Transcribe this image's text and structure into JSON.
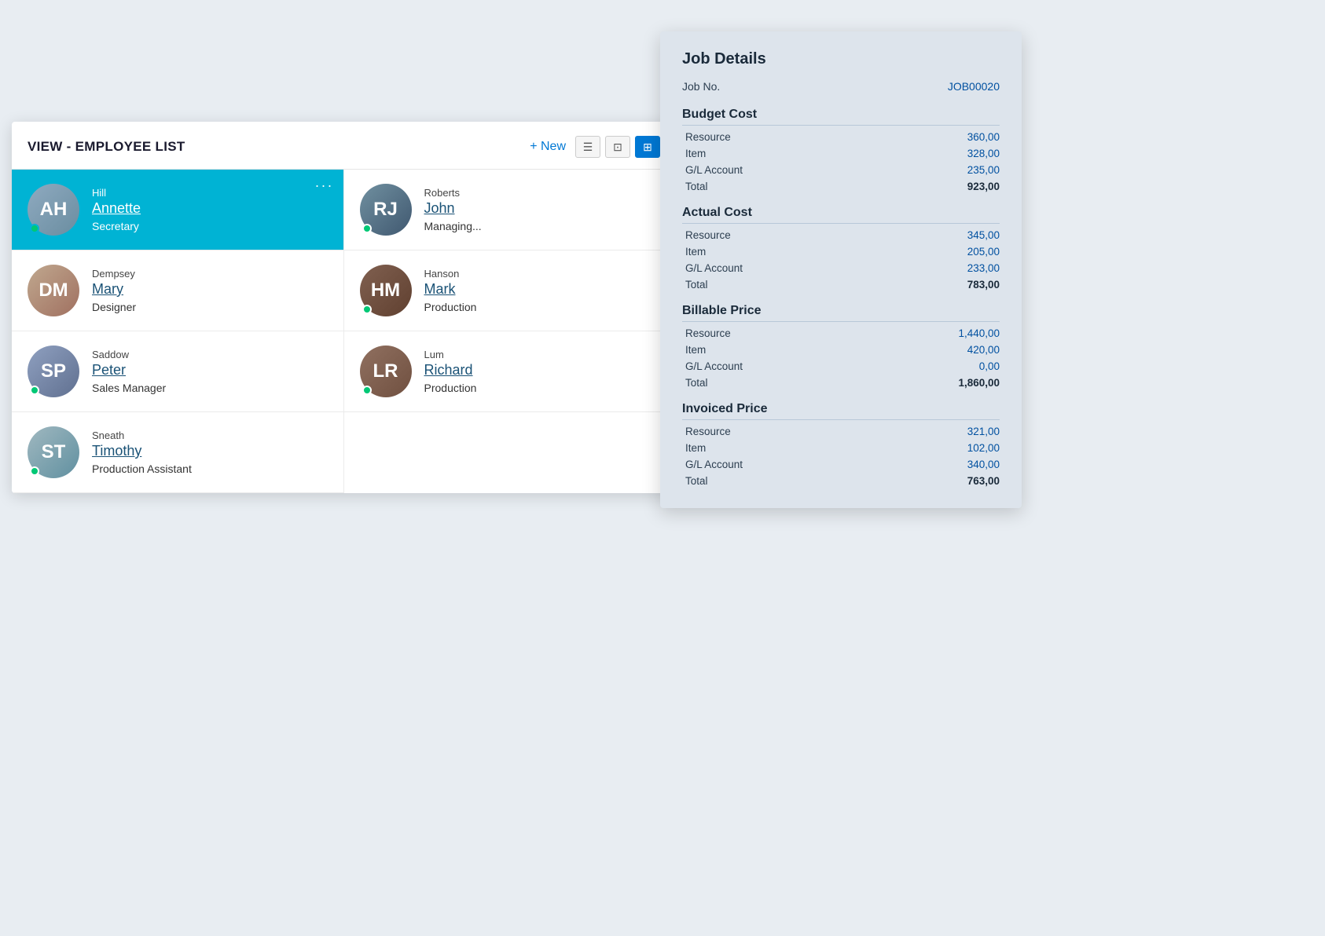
{
  "header": {
    "title": "VIEW - EMPLOYEE LIST",
    "new_label": "+ New"
  },
  "view_icons": [
    {
      "id": "list",
      "icon": "☰",
      "active": false
    },
    {
      "id": "tile",
      "icon": "⊞",
      "active": false
    },
    {
      "id": "grid",
      "icon": "⊟",
      "active": true
    }
  ],
  "employees": [
    {
      "id": "annette",
      "last": "Hill",
      "first": "Annette",
      "role": "Secretary",
      "active": true,
      "avatar_class": "av-annette",
      "initials": "AH",
      "online": true
    },
    {
      "id": "roberts",
      "last": "Roberts",
      "first": "John",
      "role": "Managing...",
      "active": false,
      "avatar_class": "av-roberts",
      "initials": "RJ",
      "online": true
    },
    {
      "id": "mary",
      "last": "Dempsey",
      "first": "Mary",
      "role": "Designer",
      "active": false,
      "avatar_class": "av-mary",
      "initials": "DM",
      "online": false
    },
    {
      "id": "hanson",
      "last": "Hanson",
      "first": "Mark",
      "role": "Production",
      "active": false,
      "avatar_class": "av-hanson",
      "initials": "HM",
      "online": true
    },
    {
      "id": "peter",
      "last": "Saddow",
      "first": "Peter",
      "role": "Sales Manager",
      "active": false,
      "avatar_class": "av-peter",
      "initials": "SP",
      "online": true
    },
    {
      "id": "lum",
      "last": "Lum",
      "first": "Richard",
      "role": "Production",
      "active": false,
      "avatar_class": "av-lum",
      "initials": "LR",
      "online": true
    },
    {
      "id": "timothy",
      "last": "Sneath",
      "first": "Timothy",
      "role": "Production Assistant",
      "active": false,
      "avatar_class": "av-timothy",
      "initials": "ST",
      "online": true
    }
  ],
  "job_details": {
    "title": "Job Details",
    "job_no_label": "Job No.",
    "job_no_value": "JOB00020",
    "sections": [
      {
        "name": "Budget Cost",
        "rows": [
          {
            "label": "Resource",
            "value": "360,00"
          },
          {
            "label": "Item",
            "value": "328,00"
          },
          {
            "label": "G/L Account",
            "value": "235,00"
          },
          {
            "label": "Total",
            "value": "923,00",
            "bold": true
          }
        ]
      },
      {
        "name": "Actual Cost",
        "rows": [
          {
            "label": "Resource",
            "value": "345,00"
          },
          {
            "label": "Item",
            "value": "205,00"
          },
          {
            "label": "G/L Account",
            "value": "233,00"
          },
          {
            "label": "Total",
            "value": "783,00",
            "bold": true
          }
        ]
      },
      {
        "name": "Billable Price",
        "rows": [
          {
            "label": "Resource",
            "value": "1,440,00"
          },
          {
            "label": "Item",
            "value": "420,00"
          },
          {
            "label": "G/L Account",
            "value": "0,00"
          },
          {
            "label": "Total",
            "value": "1,860,00",
            "bold": true
          }
        ]
      },
      {
        "name": "Invoiced Price",
        "rows": [
          {
            "label": "Resource",
            "value": "321,00"
          },
          {
            "label": "Item",
            "value": "102,00"
          },
          {
            "label": "G/L Account",
            "value": "340,00"
          },
          {
            "label": "Total",
            "value": "763,00",
            "bold": true
          }
        ]
      }
    ]
  }
}
